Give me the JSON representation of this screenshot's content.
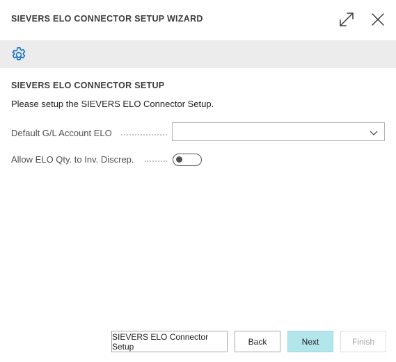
{
  "dialog": {
    "title": "SIEVERS ELO CONNECTOR SETUP WIZARD",
    "expand_icon": "expand-icon",
    "close_icon": "close-icon"
  },
  "toolbar": {
    "icon": "gear-icon"
  },
  "page": {
    "section_title": "SIEVERS ELO CONNECTOR SETUP",
    "instructions": "Please setup the SIEVERS ELO Connector Setup."
  },
  "fields": {
    "default_gl_account": {
      "label": "Default G/L Account ELO",
      "value": ""
    },
    "allow_qty_discrep": {
      "label": "Allow ELO Qty. to Inv. Discrep.",
      "value": false
    }
  },
  "footer": {
    "setup_label": "SIEVERS ELO Connector Setup",
    "back_label": "Back",
    "next_label": "Next",
    "finish_label": "Finish"
  },
  "colors": {
    "accent": "#0f6fc6",
    "next_button_bg": "#b2e6ea",
    "toolbar_bg": "#ececec"
  }
}
